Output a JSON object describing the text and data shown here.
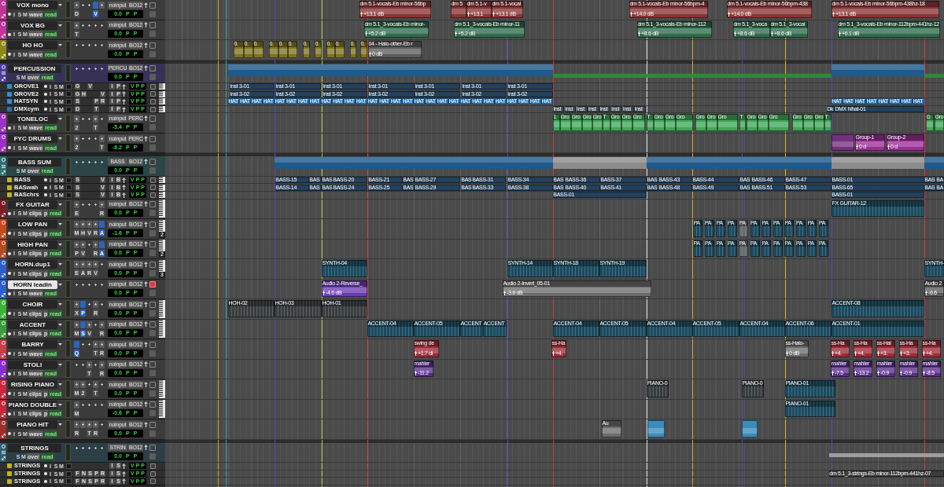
{
  "tracks": [
    {
      "kind": "audio",
      "name": "VOX mono",
      "color": "#c0359c",
      "selected": false,
      "armed": false,
      "keyboard": false,
      "buttons": [
        "I",
        "S",
        "M"
      ],
      "view": "wave",
      "automation": "read",
      "slots": [
        {
          "filled": true,
          "active": false,
          "label": "D"
        },
        {
          "filled": false,
          "active": false
        },
        {
          "filled": false,
          "active": false
        },
        {
          "filled": false,
          "active": true,
          "label": "V"
        },
        {
          "filled": true,
          "active": false
        }
      ],
      "io": [
        "noinput",
        "BO12"
      ],
      "display": [
        "0.0",
        "P",
        "P"
      ],
      "clips": [
        {
          "name": "dm 5.1-vocals-Eb minor-56bp",
          "gain": "+13.1 dB"
        },
        {
          "name": "dm 5"
        },
        {
          "name": "dm 5.1-v",
          "gain": "+13.1"
        },
        {
          "name": "dm 5.1-vocal",
          "gain": "+13.1 dB"
        },
        {
          "name": "dm 5.1-vocals-Eb minor-56bpm-4",
          "gain": "+14.0 dB"
        },
        {
          "name": "dm 5.1-vocals-Eb minor-56bpm-438",
          "gain": "+14.0 dB"
        },
        {
          "name": "dm 5.1-vocals-Eb minor-56bpm-438hz-18",
          "gain": "+13.1 dB"
        }
      ]
    },
    {
      "kind": "audio",
      "name": "VOX BG",
      "color": "#c0359c",
      "selected": false,
      "armed": false,
      "keyboard": false,
      "buttons": [
        "I",
        "S",
        "M"
      ],
      "view": "wave",
      "automation": "read",
      "slots": [
        {
          "filled": true,
          "active": false,
          "label": "T"
        },
        {
          "filled": false,
          "active": false
        },
        {
          "filled": false,
          "active": false
        },
        {
          "filled": false,
          "active": false
        },
        {
          "filled": false,
          "active": false
        }
      ],
      "io": [
        "noinput",
        "BO12"
      ],
      "display": [
        "0.0",
        "P",
        "P"
      ],
      "clips": [
        {
          "name": "dm 5.1_3-vocals-Eb minor-",
          "gain": "+5.2 dB"
        },
        {
          "name": "dm 5.1_3-vocals-Eb minor-11",
          "gain": "+5.2 dB"
        },
        {
          "name": "dm 5.1_3-vocals-Eb minor-112",
          "gain": "+8.6 dB"
        },
        {
          "name": "dm 5.1_3-voca",
          "gain": "+8.6 dB"
        },
        {
          "name": "dm 5.1_3-vocal",
          "gain": "+8.6 dB"
        },
        {
          "name": "dm 5.1_3-vocals-Eb minor-112bpm-441hz-12",
          "gain": "+6.1 dB"
        }
      ]
    },
    {
      "kind": "audio",
      "name": "HO HO",
      "color": "#8c8a1e",
      "selected": false,
      "armed": false,
      "keyboard": false,
      "buttons": [
        "I",
        "S",
        "M"
      ],
      "view": "wave",
      "automation": "read",
      "slots": [
        {
          "filled": false,
          "active": false
        },
        {
          "filled": false,
          "active": false
        },
        {
          "filled": false,
          "active": false
        },
        {
          "filled": false,
          "active": false
        },
        {
          "filled": false,
          "active": false
        }
      ],
      "io": [
        "noinput",
        "BO12"
      ],
      "display": [
        "0.0",
        "P",
        "P"
      ],
      "clips": [
        {
          "name": "0.",
          "color": "#7e7420"
        },
        {
          "name": "0.",
          "color": "#7e7420"
        },
        {
          "name": "0.",
          "color": "#7e7420"
        },
        {
          "name": "0.",
          "color": "#7e7420"
        },
        {
          "name": "0.",
          "color": "#7e7420"
        },
        {
          "name": "0.",
          "color": "#7e7420"
        },
        {
          "name": "0.",
          "color": "#7e7420"
        },
        {
          "name": "0.",
          "color": "#7e7420"
        },
        {
          "name": "0.",
          "color": "#7e7420"
        },
        {
          "name": "0.",
          "color": "#7e7420"
        },
        {
          "name": "0.",
          "color": "#7e7420"
        },
        {
          "name": "0.",
          "color": "#7e7420"
        },
        {
          "name": "04 - Halo-other-Eb r",
          "gain": "0 dB",
          "color": "#5c5c5c"
        }
      ]
    },
    {
      "kind": "folder",
      "name": "PERCUSSION",
      "color": "#4b3e9a",
      "selected": false,
      "armed": false,
      "buttons": [
        "S",
        "M"
      ],
      "view": "over",
      "automation": "read",
      "slots": [
        {
          "filled": false,
          "active": false
        },
        {
          "filled": false,
          "active": false
        },
        {
          "filled": false,
          "active": false
        },
        {
          "filled": false,
          "active": false
        },
        {
          "filled": false,
          "active": false
        }
      ],
      "io": [
        "PERCU",
        "BO12"
      ],
      "display": [
        "0.0",
        "P",
        "P"
      ],
      "clips": [
        {
          "kind": "bar",
          "color": "#1f5a8c"
        },
        {
          "kind": "line",
          "color": "#2e8a3a"
        },
        {
          "kind": "line",
          "color": "#2e8a3a"
        },
        {
          "kind": "bar",
          "color": "#1f5a8c"
        },
        {
          "kind": "line",
          "color": "#2e8a3a"
        }
      ]
    },
    {
      "kind": "sub",
      "name": "GROVE1",
      "color": "#2f8fd3",
      "selected": false,
      "armed": false,
      "keyboard": true,
      "buttons": [
        "I",
        "S",
        "M"
      ],
      "sends": [
        {
          "used": true,
          "label": "G"
        },
        {
          "used": false
        },
        {
          "used": true,
          "label": "V"
        },
        {
          "used": false
        },
        {
          "used": false
        }
      ],
      "io": [
        "I",
        "P"
      ],
      "display": [
        "V",
        "P",
        "P"
      ],
      "clips": [
        {
          "name": "Inst 3-01"
        },
        {
          "name": "Inst 3-01"
        },
        {
          "name": "Inst 3-01"
        },
        {
          "name": "Inst 3-01"
        },
        {
          "name": "Inst 3-01"
        },
        {
          "name": "Inst 3-01"
        },
        {
          "name": "Inst 3-01"
        }
      ]
    },
    {
      "kind": "sub",
      "name": "GROVE2",
      "color": "#2f8fd3",
      "selected": false,
      "armed": false,
      "keyboard": true,
      "buttons": [
        "I",
        "S",
        "M"
      ],
      "sends": [
        {
          "used": true,
          "label": "G"
        },
        {
          "used": true,
          "label": "H"
        },
        {
          "used": false
        },
        {
          "used": false
        },
        {
          "used": true,
          "label": "V"
        }
      ],
      "io": [
        "I",
        "P"
      ],
      "display": [
        "V",
        "P",
        "P"
      ],
      "clips": [
        {
          "name": "Inst 3-02"
        },
        {
          "name": "Inst 3-02"
        },
        {
          "name": "Inst 3-02"
        },
        {
          "name": "Inst 3-02"
        },
        {
          "name": "Inst 3-02"
        },
        {
          "name": "Inst 3-02"
        },
        {
          "name": "Inst 3-02"
        }
      ]
    },
    {
      "kind": "sub",
      "name": "HATSYN",
      "color": "#2f8fd3",
      "selected": false,
      "armed": false,
      "keyboard": true,
      "buttons": [
        "I",
        "S",
        "M"
      ],
      "sends": [
        {
          "used": true,
          "label": "S"
        },
        {
          "used": false
        },
        {
          "used": false
        },
        {
          "used": true,
          "label": "P"
        },
        {
          "used": true,
          "label": "R"
        }
      ],
      "io": [
        "I",
        "P"
      ],
      "display": [
        "V",
        "P",
        "P"
      ],
      "clips": [
        {
          "name": "HAT"
        },
        {
          "name": "HAT"
        },
        {
          "name": "HAT"
        },
        {
          "name": "HAT"
        },
        {
          "name": "HAT"
        },
        {
          "name": "HAT"
        },
        {
          "name": "HAT"
        },
        {
          "name": "HAT"
        },
        {
          "name": "HAT"
        },
        {
          "name": "HAT"
        },
        {
          "name": "HAT"
        },
        {
          "name": "HAT"
        },
        {
          "name": "HAT"
        },
        {
          "name": "HAT"
        },
        {
          "name": "HAT"
        },
        {
          "name": "HAT"
        },
        {
          "name": "HAT"
        },
        {
          "name": "HAT"
        },
        {
          "name": "HAT"
        },
        {
          "name": "HAT"
        },
        {
          "name": "HAT"
        },
        {
          "name": "HAT"
        },
        {
          "name": "HAT"
        },
        {
          "name": "HAT"
        },
        {
          "name": "HAT"
        },
        {
          "name": "HAT"
        },
        {
          "name": "HAT"
        },
        {
          "name": "HAT"
        },
        {
          "name": "HAT"
        },
        {
          "name": "HAT"
        },
        {
          "name": "HAT"
        },
        {
          "name": "HAT"
        },
        {
          "name": "HAT"
        },
        {
          "name": "HAT"
        },
        {
          "name": "HAT"
        },
        {
          "name": "HAT"
        }
      ]
    },
    {
      "kind": "sub",
      "name": "DMXcym",
      "color": "#2a70ab",
      "selected": false,
      "armed": false,
      "keyboard": true,
      "buttons": [
        "I",
        "S",
        "M"
      ],
      "sends": [
        {
          "used": true,
          "label": "D"
        },
        {
          "used": false
        },
        {
          "used": false
        },
        {
          "used": true,
          "label": "T"
        },
        {
          "used": false
        }
      ],
      "io": [
        "I",
        "P"
      ],
      "display": [
        "V",
        "P",
        "P"
      ],
      "clips": [
        {
          "name": "Inst",
          "color": "#3c4650"
        },
        {
          "name": "Inst",
          "color": "#3c4650"
        },
        {
          "name": "Inst",
          "color": "#3c4650"
        },
        {
          "name": "Inst",
          "color": "#3c4650"
        },
        {
          "name": "Inst",
          "color": "#3c4650"
        },
        {
          "name": "Inst",
          "color": "#3c4650"
        },
        {
          "name": "Inst",
          "color": "#3c4650"
        },
        {
          "name": "Inst",
          "color": "#3c4650"
        },
        {
          "name": "Dk",
          "color": "#24405a"
        },
        {
          "name": "DMX hihat-01",
          "color": "#24405a"
        }
      ]
    },
    {
      "kind": "audio",
      "name": "TONELOC",
      "color": "#9c33c4",
      "selected": false,
      "armed": false,
      "keyboard": false,
      "buttons": [
        "I",
        "S",
        "M"
      ],
      "view": "wave",
      "automation": "read",
      "slots": [
        {
          "filled": true,
          "active": false,
          "label": "2"
        },
        {
          "filled": false,
          "active": false
        },
        {
          "filled": false,
          "active": false
        },
        {
          "filled": true,
          "active": false,
          "label": "T"
        },
        {
          "filled": false,
          "active": false
        }
      ],
      "io": [
        "noinput",
        "PERC"
      ],
      "display": [
        "-5.4",
        "P",
        "P"
      ],
      "clips": [
        {
          "name": "1"
        },
        {
          "name": "Gro"
        },
        {
          "name": "Gro"
        },
        {
          "name": "Gro"
        },
        {
          "name": "Gro"
        },
        {
          "name": "T"
        },
        {
          "name": "Gro"
        },
        {
          "name": "Gro"
        },
        {
          "name": "Gro"
        },
        {
          "name": "T"
        },
        {
          "name": "Gro"
        },
        {
          "name": "Gro"
        },
        {
          "name": "Gro"
        },
        {
          "name": "Gro"
        },
        {
          "name": "Gro"
        },
        {
          "name": "Gro"
        },
        {
          "name": "T"
        },
        {
          "name": "Gro"
        },
        {
          "name": "Gro"
        },
        {
          "name": "Gro"
        },
        {
          "name": "Gro"
        },
        {
          "name": "Gro"
        },
        {
          "name": "Gro"
        },
        {
          "name": "T"
        },
        {
          "name": "G"
        },
        {
          "name": "Gro"
        }
      ]
    },
    {
      "kind": "audio",
      "name": "FYC DRUMS",
      "color": "#9c33c4",
      "selected": false,
      "armed": false,
      "keyboard": false,
      "buttons": [
        "I",
        "S",
        "M"
      ],
      "view": "wave",
      "automation": "read",
      "slots": [
        {
          "filled": true,
          "active": false,
          "label": "2"
        },
        {
          "filled": false,
          "active": false
        },
        {
          "filled": false,
          "active": false
        },
        {
          "filled": false,
          "active": false
        },
        {
          "filled": true,
          "active": false,
          "label": "T"
        }
      ],
      "io": [
        "noinput",
        "PERC"
      ],
      "display": [
        "-6.2",
        "P",
        "P"
      ],
      "clips": [
        {
          "color": "#74307e"
        },
        {
          "name": "Group-1",
          "gain": "0 d",
          "color": "#9a3096"
        },
        {
          "name": "Group-2",
          "gain": "0 d",
          "color": "#9a3096"
        }
      ]
    },
    {
      "kind": "folder",
      "name": "BASS SUM",
      "color": "#2e7374",
      "selected": false,
      "armed": false,
      "buttons": [
        "S",
        "M"
      ],
      "view": "over",
      "automation": "read",
      "slots": [
        {
          "filled": false,
          "active": false
        },
        {
          "filled": false,
          "active": false
        },
        {
          "filled": false,
          "active": false
        },
        {
          "filled": false,
          "active": false
        },
        {
          "filled": false,
          "active": false
        }
      ],
      "io": [
        "BASS",
        "BO12"
      ],
      "display": [
        "0.0",
        "P",
        "P"
      ],
      "clips": [
        {
          "kind": "bar",
          "color": "#1f5a8c"
        },
        {
          "kind": "bar",
          "color": "#8c8c8c"
        },
        {
          "kind": "bar",
          "color": "#1f5a8c"
        },
        {
          "kind": "bar",
          "color": "#8c8c8c"
        },
        {
          "kind": "bar",
          "color": "#1f5a8c"
        }
      ]
    },
    {
      "kind": "sub",
      "name": "BASS",
      "color": "#c0b424",
      "selected": false,
      "armed": false,
      "keyboard": true,
      "buttons": [
        "I",
        "S",
        "M"
      ],
      "sends": [
        {
          "used": true,
          "label": "S"
        },
        {
          "used": false
        },
        {
          "used": false
        },
        {
          "used": false
        },
        {
          "used": true,
          "label": "V"
        }
      ],
      "io": [
        "I",
        "B"
      ],
      "display": [
        "V",
        "P",
        "P"
      ],
      "clips": [
        {
          "name": "BASS-15"
        },
        {
          "name": "BAS"
        },
        {
          "name": "BAS"
        },
        {
          "name": "BASS-20"
        },
        {
          "name": "BASS-21"
        },
        {
          "name": "BAS"
        },
        {
          "name": "BASS-27"
        },
        {
          "name": "BAS"
        },
        {
          "name": "BASS-31"
        },
        {
          "name": "BASS-34"
        },
        {
          "name": "BAS"
        },
        {
          "name": "BASS-36"
        },
        {
          "name": "BASS-37"
        },
        {
          "name": "BAS"
        },
        {
          "name": "BASS-43"
        },
        {
          "name": "BASS-44"
        },
        {
          "name": "BAS"
        },
        {
          "name": "BASS-46"
        },
        {
          "name": "BASS-47"
        },
        {
          "name": "BASS-01"
        },
        {
          "name": "BAS"
        },
        {
          "name": "BA"
        }
      ]
    },
    {
      "kind": "sub",
      "name": "BASwah",
      "color": "#c0b424",
      "selected": false,
      "armed": false,
      "keyboard": true,
      "buttons": [
        "I",
        "S",
        "M"
      ],
      "sends": [
        {
          "used": true,
          "label": "S"
        },
        {
          "used": false
        },
        {
          "used": false
        },
        {
          "used": false
        },
        {
          "used": true,
          "label": "V"
        }
      ],
      "io": [
        "I",
        "B"
      ],
      "display": [
        "V",
        "P",
        "P"
      ],
      "clips": [
        {
          "name": "BASS-14"
        },
        {
          "name": "BAS"
        },
        {
          "name": "BAS"
        },
        {
          "name": "BASS-24"
        },
        {
          "name": "BASS-25"
        },
        {
          "name": "BAS"
        },
        {
          "name": "BASS-29"
        },
        {
          "name": "BAS"
        },
        {
          "name": "BASS-33"
        },
        {
          "name": "BASS-38"
        },
        {
          "name": "BAS"
        },
        {
          "name": "BASS-40"
        },
        {
          "name": "BASS-41"
        },
        {
          "name": "BAS"
        },
        {
          "name": "BASS-48"
        },
        {
          "name": "BASS-49"
        },
        {
          "name": "BAS"
        },
        {
          "name": "BASS-51"
        },
        {
          "name": "BASS-53"
        },
        {
          "name": "BASS-65"
        },
        {
          "name": "BAS"
        },
        {
          "name": "BA"
        }
      ]
    },
    {
      "kind": "sub",
      "name": "BASchrs",
      "color": "#c0b424",
      "selected": false,
      "armed": false,
      "keyboard": true,
      "buttons": [
        "I",
        "S",
        "M"
      ],
      "sends": [
        {
          "used": true,
          "label": "S"
        },
        {
          "used": false
        },
        {
          "used": false
        },
        {
          "used": false
        },
        {
          "used": true,
          "label": "V"
        }
      ],
      "io": [
        "I",
        "B"
      ],
      "display": [
        "V",
        "P",
        "P"
      ],
      "clips": [
        {
          "name": "BASS-01"
        },
        {
          "name": "BASS-01"
        }
      ]
    },
    {
      "kind": "audio",
      "name": "FX GUITAR",
      "color": "#7c1c22",
      "selected": false,
      "armed": false,
      "keyboard": true,
      "buttons": [
        "I",
        "S",
        "M"
      ],
      "view": "clips",
      "p_button": "p",
      "automation": "read",
      "slots": [
        {
          "filled": true,
          "active": false,
          "label": "E"
        },
        {
          "filled": false,
          "active": false
        },
        {
          "filled": false,
          "active": false
        },
        {
          "filled": false,
          "active": false
        },
        {
          "filled": true,
          "active": false,
          "label": "R"
        }
      ],
      "io": [
        "noinput",
        "BO12"
      ],
      "display": [
        "0.0",
        "P",
        "P"
      ],
      "clips": [
        {
          "name": "FX GUITAR-12"
        }
      ]
    },
    {
      "kind": "audio",
      "name": "LOW PAN",
      "color": "#c44c1c",
      "selected": false,
      "armed": false,
      "keyboard": true,
      "keyboard_label": "2",
      "buttons": [
        "I",
        "S",
        "M"
      ],
      "view": "clips",
      "p_button": "p",
      "automation": "read",
      "slots": [
        {
          "filled": true,
          "active": false,
          "label": "M"
        },
        {
          "filled": true,
          "active": false,
          "label": "H"
        },
        {
          "filled": true,
          "active": false,
          "label": "V"
        },
        {
          "filled": true,
          "active": false,
          "label": "R"
        },
        {
          "filled": false,
          "active": true,
          "label": "A"
        }
      ],
      "io": [
        "noinput",
        "BO12"
      ],
      "display": [
        "-1.6",
        "P",
        "P"
      ],
      "clips": [
        {
          "name": "PA",
          "muted": false
        },
        {
          "name": "PA",
          "muted": false
        },
        {
          "name": "PA",
          "muted": false
        },
        {
          "name": "PA",
          "muted": false
        },
        {
          "name": "PA",
          "muted": true
        },
        {
          "name": "PA",
          "muted": false
        },
        {
          "name": "PA",
          "muted": false
        },
        {
          "name": "PA",
          "muted": false
        },
        {
          "name": "PA",
          "muted": false
        },
        {
          "name": "PA",
          "muted": false
        },
        {
          "name": "PA",
          "muted": false
        },
        {
          "name": "PA",
          "muted": false
        }
      ]
    },
    {
      "kind": "audio",
      "name": "HIGH PAN",
      "color": "#b8481e",
      "selected": false,
      "armed": false,
      "keyboard": true,
      "keyboard_label": "2",
      "buttons": [
        "I",
        "S",
        "M"
      ],
      "view": "clips",
      "p_button": "p",
      "automation": "read",
      "slots": [
        {
          "filled": true,
          "active": false,
          "label": "P"
        },
        {
          "filled": true,
          "active": false,
          "label": "V"
        },
        {
          "filled": false,
          "active": false
        },
        {
          "filled": true,
          "active": false,
          "label": "R"
        },
        {
          "filled": false,
          "active": true,
          "label": "A"
        }
      ],
      "io": [
        "noinput",
        "BO12"
      ],
      "display": [
        "0.0",
        "P",
        "P"
      ],
      "clips": [
        {
          "name": "PA",
          "muted": false
        },
        {
          "name": "PA",
          "muted": false
        },
        {
          "name": "PA",
          "muted": false
        },
        {
          "name": "PA",
          "muted": false
        },
        {
          "name": "PA",
          "muted": true
        },
        {
          "name": "PA",
          "muted": false
        },
        {
          "name": "PA",
          "muted": false
        },
        {
          "name": "PA",
          "muted": false
        },
        {
          "name": "PA",
          "muted": false
        },
        {
          "name": "PA",
          "muted": false
        },
        {
          "name": "PA",
          "muted": false
        },
        {
          "name": "PA",
          "muted": false
        }
      ]
    },
    {
      "kind": "audio",
      "name": "HORN.dup1",
      "color": "#2b5fcc",
      "selected": false,
      "armed": false,
      "keyboard": true,
      "keyboard_label": "3",
      "buttons": [
        "I",
        "S",
        "M"
      ],
      "view": "clips",
      "p_button": "p",
      "automation": "read",
      "slots": [
        {
          "filled": true,
          "active": false,
          "label": "E"
        },
        {
          "filled": true,
          "active": false,
          "label": "A"
        },
        {
          "filled": true,
          "active": false,
          "label": "R"
        },
        {
          "filled": true,
          "active": false,
          "label": "V"
        },
        {
          "filled": false,
          "active": false
        }
      ],
      "io": [
        "noinput",
        "BO12"
      ],
      "display": [
        "0.0",
        "P",
        "P"
      ],
      "clips": [
        {
          "name": "SYNTH-04"
        },
        {
          "name": "SYNTH-14"
        },
        {
          "name": "SYNTH-18"
        },
        {
          "name": "SYNTH-19"
        },
        {
          "name": "SYNTH-"
        }
      ]
    },
    {
      "kind": "audio",
      "name": "HORN leadin",
      "color": "#2b5fcc",
      "selected": true,
      "armed": true,
      "keyboard": false,
      "buttons": [
        "I",
        "S",
        "M"
      ],
      "view": "wave",
      "automation": "read",
      "slots": [
        {
          "filled": false,
          "active": false
        },
        {
          "filled": false,
          "active": false
        },
        {
          "filled": false,
          "active": false
        },
        {
          "filled": false,
          "active": false
        },
        {
          "filled": false,
          "active": false
        }
      ],
      "io": [
        "noinput",
        "BO12"
      ],
      "display": [
        "0.0",
        "P",
        "P"
      ],
      "clips": [
        {
          "name": "Audio 2-Reverse_",
          "gain": "-4.6 dB",
          "color": "#6a3cb4"
        },
        {
          "name": "Audio 2-Invert_05-01",
          "gain": "-3.8 dB",
          "color": "#6c6c6c"
        },
        {
          "name": "Audio 2",
          "gain": "-6.6",
          "color": "#5a5a5a"
        }
      ]
    },
    {
      "kind": "audio",
      "name": "CHOIR",
      "color": "#3cb43c",
      "selected": false,
      "armed": false,
      "keyboard": true,
      "buttons": [
        "I",
        "S",
        "M"
      ],
      "view": "clips",
      "p_button": "p",
      "automation": "read",
      "slots": [
        {
          "filled": true,
          "active": false,
          "label": "X"
        },
        {
          "filled": false,
          "active": true,
          "label": "P"
        },
        {
          "filled": false,
          "active": false
        },
        {
          "filled": true,
          "active": false,
          "label": "R"
        },
        {
          "filled": false,
          "active": false
        }
      ],
      "io": [
        "noinput",
        "BO12"
      ],
      "display": [
        "0.0",
        "P",
        "P"
      ],
      "clips": [
        {
          "name": "HOH-02",
          "color": "#3d3d3d"
        },
        {
          "name": "HOH-03",
          "color": "#3d3d3d"
        },
        {
          "name": "HOH-01",
          "color": "#3d3d3d"
        },
        {
          "name": "ACCENT-08",
          "color": "#1e4a5e"
        }
      ]
    },
    {
      "kind": "audio",
      "name": "ACCENT",
      "color": "#3c9c3c",
      "selected": false,
      "armed": false,
      "keyboard": true,
      "buttons": [
        "I",
        "S",
        "M"
      ],
      "view": "clips",
      "p_button": "p",
      "automation": "read",
      "slots": [
        {
          "filled": true,
          "active": false,
          "label": "M"
        },
        {
          "filled": false,
          "active": true,
          "label": "S"
        },
        {
          "filled": true,
          "active": false,
          "label": "V"
        },
        {
          "filled": false,
          "active": false
        },
        {
          "filled": true,
          "active": false,
          "label": "R"
        }
      ],
      "io": [
        "noinput",
        "BO12"
      ],
      "display": [
        "0.0",
        "P",
        "P"
      ],
      "clips": [
        {
          "name": "ACCENT-04"
        },
        {
          "name": "ACCENT-05"
        },
        {
          "name": "ACCENT"
        },
        {
          "name": "ACCENT"
        },
        {
          "name": "ACCENT-04"
        },
        {
          "name": "ACCENT-05"
        },
        {
          "name": "ACCENT-04"
        },
        {
          "name": "ACCENT-05"
        },
        {
          "name": "ACCENT-04"
        },
        {
          "name": "ACCENT-06"
        },
        {
          "name": "ACCENT-01"
        }
      ]
    },
    {
      "kind": "audio",
      "name": "BARRY",
      "color": "#c83c4c",
      "selected": false,
      "armed": false,
      "keyboard": false,
      "buttons": [
        "I",
        "S",
        "M"
      ],
      "view": "wave",
      "automation": "read",
      "slots": [
        {
          "filled": false,
          "active": true,
          "label": "Q"
        },
        {
          "filled": false,
          "active": false
        },
        {
          "filled": false,
          "active": false
        },
        {
          "filled": true,
          "active": false,
          "label": "T"
        },
        {
          "filled": true,
          "active": false,
          "label": "R"
        }
      ],
      "io": [
        "noinput",
        "BO12"
      ],
      "display": [
        "0.0",
        "P",
        "P"
      ],
      "clips": [
        {
          "name": "swing de",
          "gain": "+1.7 dl",
          "color": "#9c2c38"
        },
        {
          "name": "ss-Ha",
          "gain": "+4.",
          "color": "#9c2c38"
        },
        {
          "name": "ss-Halo-",
          "gain": "0 dB",
          "color": "#6c6c6c"
        },
        {
          "name": "ss-Ha",
          "gain": "+4.",
          "color": "#9c2c38"
        },
        {
          "name": "ss-Ha",
          "gain": "+4.",
          "color": "#9c2c38"
        },
        {
          "name": "ss-Hal",
          "gain": "+3.",
          "color": "#9c2c38"
        },
        {
          "name": "ss-Ha",
          "gain": "+3.",
          "color": "#9c2c38"
        },
        {
          "name": "ss-Ha",
          "gain": "+4.",
          "color": "#9c2c38"
        }
      ]
    },
    {
      "kind": "audio",
      "name": "STOLI",
      "color": "#8c2cd4",
      "selected": false,
      "armed": false,
      "keyboard": false,
      "buttons": [
        "I",
        "S",
        "M"
      ],
      "view": "wave",
      "automation": "read",
      "slots": [
        {
          "filled": false,
          "active": false
        },
        {
          "filled": false,
          "active": false
        },
        {
          "filled": true,
          "active": false,
          "label": "T"
        },
        {
          "filled": false,
          "active": false
        },
        {
          "filled": true,
          "active": false,
          "label": "R"
        }
      ],
      "io": [
        "noinput",
        "BO12"
      ],
      "display": [
        "0.0",
        "P",
        "P"
      ],
      "clips": [
        {
          "name": "mahler",
          "gain": "-11.2"
        },
        {
          "name": "mahler",
          "gain": "-7.5"
        },
        {
          "name": "mahler",
          "gain": "-13.2"
        },
        {
          "name": "mahler",
          "gain": "-0.9"
        },
        {
          "name": "mahler",
          "gain": "-0.9"
        },
        {
          "name": "mahler",
          "gain": "-8.5"
        }
      ]
    },
    {
      "kind": "audio",
      "name": "RISING PIANO",
      "color": "#c82a3c",
      "selected": false,
      "armed": false,
      "keyboard": true,
      "buttons": [
        "I",
        "S",
        "M"
      ],
      "view": "clips",
      "p_button": "p",
      "automation": "read",
      "slots": [
        {
          "filled": true,
          "active": false,
          "label": "M"
        },
        {
          "filled": true,
          "active": false,
          "label": "2"
        },
        {
          "filled": false,
          "active": false
        },
        {
          "filled": true,
          "active": false,
          "label": "T"
        },
        {
          "filled": false,
          "active": false
        }
      ],
      "io": [
        "noinput",
        "BO12"
      ],
      "display": [
        "0.0",
        "P",
        "P"
      ],
      "clips": [
        {
          "name": "PIANO-0",
          "color": "#3d3d3d"
        },
        {
          "name": "PIANO-0",
          "color": "#3d3d3d"
        },
        {
          "name": "PIANO-01",
          "color": "#1e4a5e"
        }
      ]
    },
    {
      "kind": "audio",
      "name": "PIANO DOUBLE",
      "color": "#c4283a",
      "selected": false,
      "armed": false,
      "keyboard": true,
      "buttons": [
        "I",
        "S",
        "M"
      ],
      "view": "clips",
      "p_button": "p",
      "automation": "read",
      "slots": [
        {
          "filled": true,
          "active": false,
          "label": "M"
        },
        {
          "filled": false,
          "active": false
        },
        {
          "filled": false,
          "active": false
        },
        {
          "filled": false,
          "active": false
        },
        {
          "filled": false,
          "active": false
        }
      ],
      "io": [
        "noinput",
        "BO12"
      ],
      "display": [
        "-0.6",
        "P",
        "P"
      ],
      "clips": [
        {
          "name": "PIANO-01"
        }
      ]
    },
    {
      "kind": "audio",
      "name": "PIANO HIT",
      "color": "#a02c2c",
      "selected": false,
      "armed": false,
      "keyboard": false,
      "buttons": [
        "I",
        "S",
        "M"
      ],
      "view": "wave",
      "automation": "read",
      "slots": [
        {
          "filled": true,
          "active": false,
          "label": "R"
        },
        {
          "filled": true,
          "active": false
        },
        {
          "filled": true,
          "active": false,
          "label": "T"
        },
        {
          "filled": true,
          "active": false,
          "label": "R"
        },
        {
          "filled": false,
          "active": false
        }
      ],
      "io": [
        "noinput",
        "BO12"
      ],
      "display": [
        "0.0",
        "P",
        "P"
      ],
      "clips": [
        {
          "name": "Au",
          "color": "#6c6c6c"
        },
        {
          "color": "#3a8cbc"
        },
        {
          "color": "#3a8cbc"
        }
      ]
    },
    {
      "kind": "folder",
      "name": "STRINGS",
      "color": "#2e5f73",
      "selected": false,
      "armed": false,
      "buttons": [
        "S",
        "M"
      ],
      "view": "over",
      "automation": "read",
      "slots": [
        {
          "filled": false,
          "active": false
        },
        {
          "filled": false,
          "active": false
        },
        {
          "filled": false,
          "active": false
        },
        {
          "filled": false,
          "active": false
        },
        {
          "filled": false,
          "active": false
        }
      ],
      "io": [
        "STRIN",
        "BO12"
      ],
      "display": [
        "0.0",
        "P",
        "P"
      ],
      "clips": [
        {
          "kind": "line"
        }
      ]
    },
    {
      "kind": "sub",
      "name": "STRINGS",
      "color": "#c0b424",
      "selected": false,
      "armed": false,
      "keyboard": false,
      "buttons": [
        "I",
        "S",
        "M"
      ],
      "io": [
        "I",
        "S"
      ],
      "display": [
        "V",
        "P",
        "P"
      ]
    },
    {
      "kind": "sub",
      "name": "STRINGS",
      "color": "#c0b424",
      "selected": false,
      "armed": false,
      "keyboard": false,
      "buttons": [
        "I",
        "S",
        "M"
      ],
      "sends": [
        {
          "used": true,
          "label": "F"
        },
        {
          "used": true,
          "label": "N"
        },
        {
          "used": true,
          "label": "S"
        },
        {
          "used": true,
          "label": "P"
        },
        {
          "used": true,
          "label": "R"
        }
      ],
      "io": [
        "I",
        "S"
      ],
      "display": [
        "V",
        "P",
        "P"
      ],
      "clips": [
        {
          "name": "dm 5.1_3-strings-Eb minor-112bpm-441hz-07"
        }
      ]
    },
    {
      "kind": "sub",
      "name": "STRINGS",
      "color": "#c0b424",
      "selected": false,
      "armed": false,
      "keyboard": false,
      "buttons": [
        "I",
        "S",
        "M"
      ],
      "sends": [
        {
          "used": true,
          "label": "F"
        },
        {
          "used": true,
          "label": "N"
        },
        {
          "used": true,
          "label": "S"
        },
        {
          "used": true,
          "label": "P"
        },
        {
          "used": true,
          "label": "R"
        }
      ],
      "io": [
        "I",
        "S"
      ],
      "display": [
        "V",
        "P",
        "P"
      ]
    }
  ],
  "markers": [
    {
      "color": "#d89a2a"
    },
    {
      "color": "#3aa6b0"
    },
    {
      "color": "#5a48c0"
    },
    {
      "color": "#a8c040"
    },
    {
      "color": "#c85040"
    },
    {
      "color": "#5a48c0"
    },
    {
      "color": "#c84040"
    },
    {
      "color": "#d8d8d8"
    },
    {
      "color": "#d8a830"
    },
    {
      "color": "#5a48c0"
    },
    {
      "color": "#d8b830"
    },
    {
      "color": "#5a48c0"
    },
    {
      "color": "#c84050"
    }
  ]
}
